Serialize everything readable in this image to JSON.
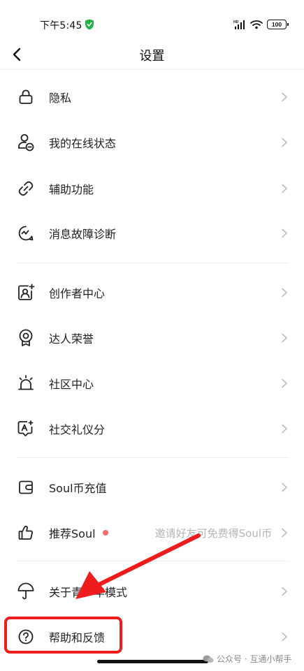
{
  "status_bar": {
    "time": "下午5:45",
    "battery": "100"
  },
  "nav": {
    "title": "设置"
  },
  "items": [
    {
      "label": "隐私"
    },
    {
      "label": "我的在线状态"
    },
    {
      "label": "辅助功能"
    },
    {
      "label": "消息故障诊断"
    },
    {
      "label": "创作者中心"
    },
    {
      "label": "达人荣誉"
    },
    {
      "label": "社区中心"
    },
    {
      "label": "社交礼仪分"
    },
    {
      "label": "Soul币充值"
    },
    {
      "label": "推荐Soul",
      "value": "邀请好友可免费得Soul币"
    },
    {
      "label": "关于青少年模式"
    },
    {
      "label": "帮助和反馈"
    }
  ],
  "watermark": {
    "text": "公众号 · 互通小帮手"
  },
  "colors": {
    "highlight": "#ee1c1c",
    "dot": "#f46b6b"
  }
}
